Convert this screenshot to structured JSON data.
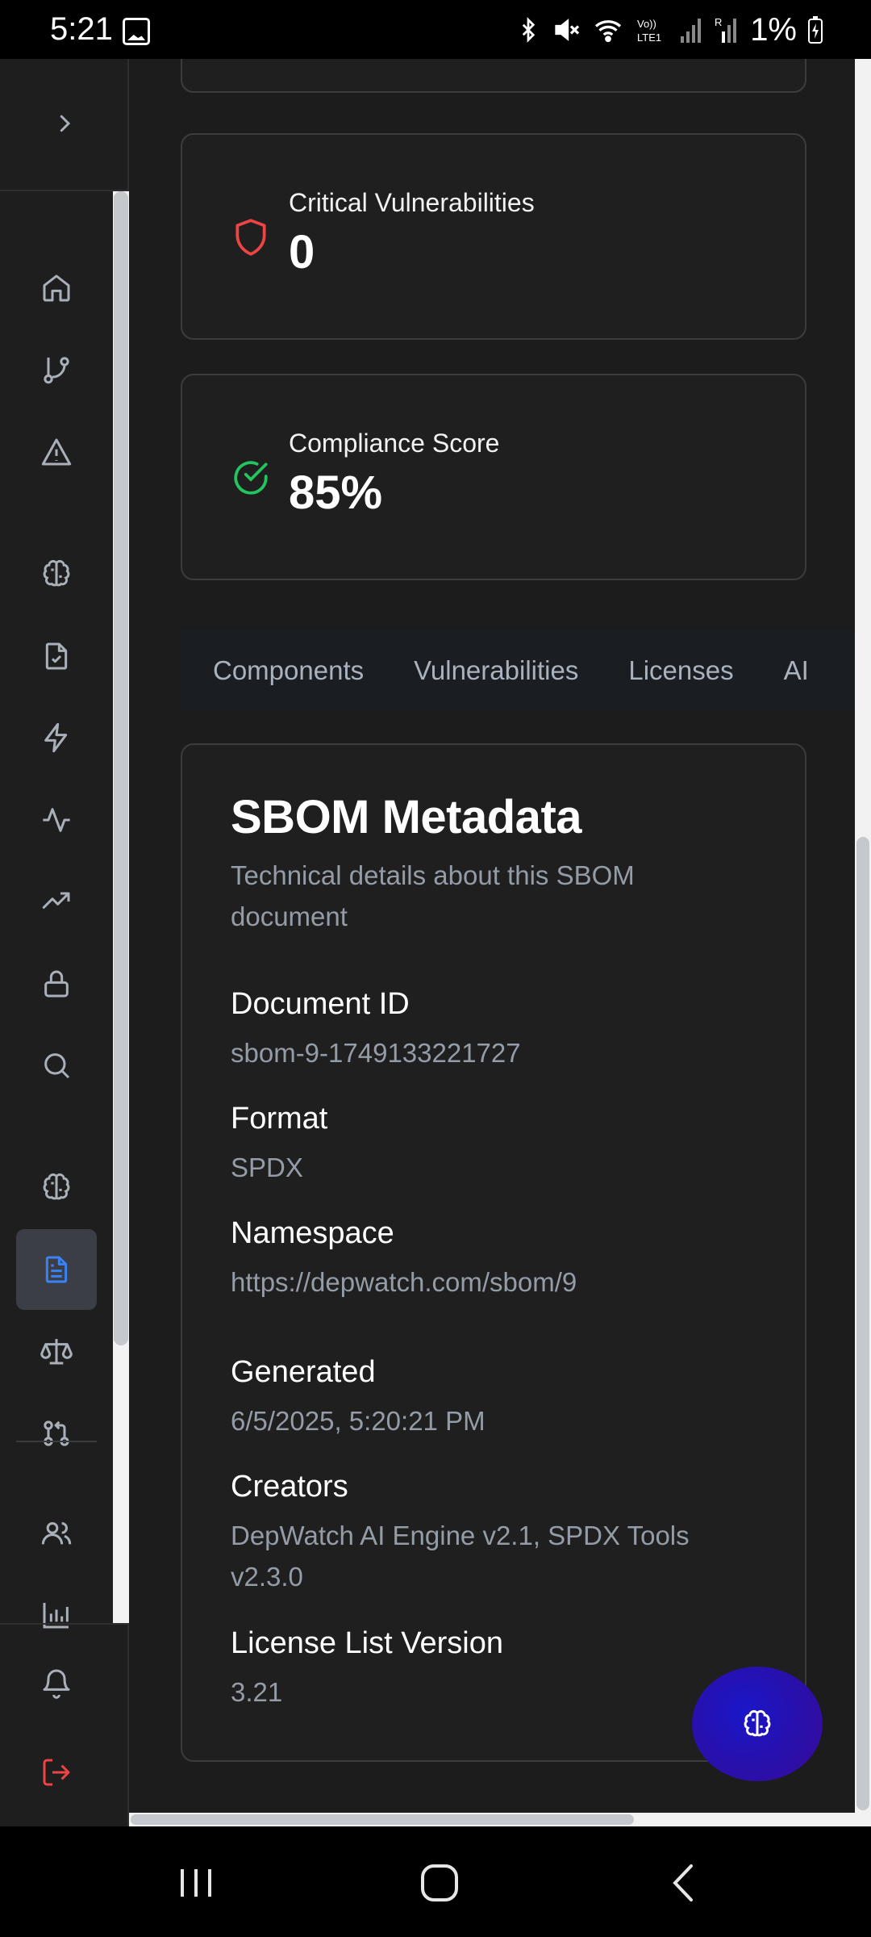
{
  "status_bar": {
    "time": "5:21",
    "battery": "1%",
    "icons": [
      "gallery-icon",
      "bluetooth-icon",
      "mute-icon",
      "wifi-icon",
      "volte-icon",
      "signal-icon",
      "signal-roaming-icon",
      "battery-charging-icon"
    ]
  },
  "sidebar": {
    "expand_icon": "chevron-right-icon",
    "items": [
      {
        "name": "home",
        "icon": "home-icon"
      },
      {
        "name": "branches",
        "icon": "git-branch-icon"
      },
      {
        "name": "alerts",
        "icon": "alert-triangle-icon"
      },
      {
        "name": "ai-insights",
        "icon": "brain-icon"
      },
      {
        "name": "compliance",
        "icon": "file-check-icon"
      },
      {
        "name": "automation",
        "icon": "zap-icon"
      },
      {
        "name": "activity",
        "icon": "activity-icon"
      },
      {
        "name": "trends",
        "icon": "trending-up-icon"
      },
      {
        "name": "security",
        "icon": "lock-icon"
      },
      {
        "name": "search",
        "icon": "search-icon"
      },
      {
        "name": "ai-assistant",
        "icon": "brain-icon"
      },
      {
        "name": "sbom",
        "icon": "file-text-icon",
        "active": true
      },
      {
        "name": "licenses",
        "icon": "scale-icon"
      },
      {
        "name": "pull-requests",
        "icon": "git-pull-request-icon"
      },
      {
        "name": "team",
        "icon": "users-icon"
      },
      {
        "name": "reports",
        "icon": "bar-chart-icon"
      }
    ],
    "footer": [
      {
        "name": "notifications",
        "icon": "bell-icon"
      },
      {
        "name": "logout",
        "icon": "log-out-icon"
      }
    ]
  },
  "stats": [
    {
      "label": "Critical Vulnerabilities",
      "value": "0",
      "icon": "shield-icon",
      "color": "#ef4444"
    },
    {
      "label": "Compliance Score",
      "value": "85%",
      "icon": "check-circle-icon",
      "color": "#22c55e"
    }
  ],
  "tabs": [
    "Components",
    "Vulnerabilities",
    "Licenses",
    "AI"
  ],
  "metadata": {
    "title": "SBOM Metadata",
    "subtitle": "Technical details about this SBOM document",
    "fields": [
      {
        "label": "Document ID",
        "value": "sbom-9-1749133221727"
      },
      {
        "label": "Format",
        "value": "SPDX"
      },
      {
        "label": "Namespace",
        "value": "https://depwatch.com/sbom/9"
      },
      {
        "label": "Generated",
        "value": "6/5/2025, 5:20:21 PM"
      },
      {
        "label": "Creators",
        "value": "DepWatch AI Engine v2.1, SPDX Tools v2.3.0"
      },
      {
        "label": "License List Version",
        "value": "3.21"
      }
    ]
  },
  "fab": {
    "icon": "brain-icon"
  },
  "nav_bar": {
    "buttons": [
      "recents-icon",
      "home-icon",
      "back-icon"
    ]
  },
  "colors": {
    "accent": "#3b82f6",
    "danger": "#ef4444",
    "success": "#22c55e",
    "logout": "#ef4444"
  }
}
